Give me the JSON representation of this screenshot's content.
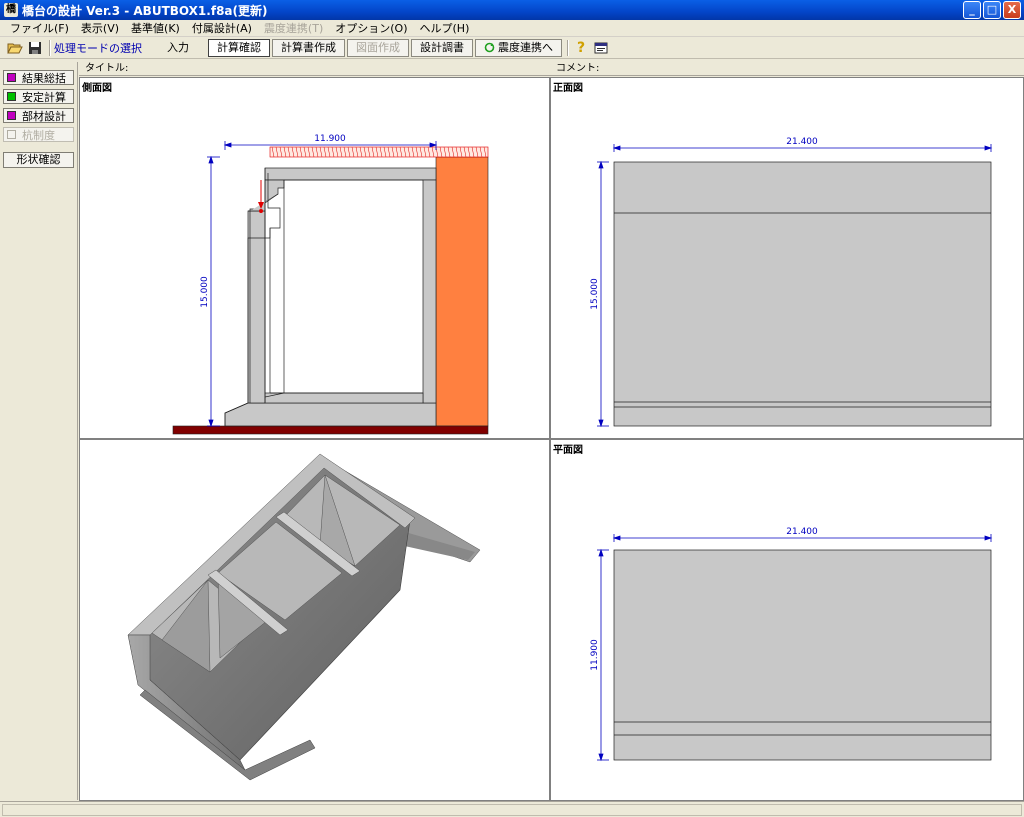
{
  "window": {
    "title": "橋台の設計 Ver.3 - ABUTBOX1.f8a(更新)",
    "app_icon": "橋",
    "buttons": [
      "_",
      "□",
      "X"
    ]
  },
  "menu": [
    {
      "label": "ファイル(F)",
      "enabled": true
    },
    {
      "label": "表示(V)",
      "enabled": true
    },
    {
      "label": "基準値(K)",
      "enabled": true
    },
    {
      "label": "付属設計(A)",
      "enabled": true
    },
    {
      "label": "震度連携(T)",
      "enabled": false
    },
    {
      "label": "オプション(O)",
      "enabled": true
    },
    {
      "label": "ヘルプ(H)",
      "enabled": true
    }
  ],
  "toolbar": {
    "open_icon": "folder-open-icon",
    "save_icon": "save-icon",
    "mode_label": "処理モードの選択",
    "buttons": [
      {
        "label": "入力",
        "state": "plain"
      },
      {
        "label": "計算確認",
        "state": "active"
      },
      {
        "label": "計算書作成",
        "state": "normal"
      },
      {
        "label": "図面作成",
        "state": "disabled"
      },
      {
        "label": "設計調書",
        "state": "normal"
      },
      {
        "label": "震度連携へ",
        "state": "normal"
      }
    ],
    "help_icon": "?",
    "about_icon": "window-icon"
  },
  "sidebar": {
    "items": [
      {
        "label": "結果総括",
        "color": "#C000C0",
        "enabled": true
      },
      {
        "label": "安定計算",
        "color": "#00C000",
        "enabled": true
      },
      {
        "label": "部材設計",
        "color": "#C000C0",
        "enabled": true
      },
      {
        "label": "杭制度",
        "color": "",
        "enabled": false
      }
    ],
    "tab": "形状確認"
  },
  "header": {
    "title_label": "タイトル:",
    "comment_label": "コメント:"
  },
  "views": {
    "side": {
      "label": "側面図",
      "width_dim": "11.900",
      "height_dim": "15.000"
    },
    "front": {
      "label": "正面図",
      "width_dim": "21.400",
      "height_dim": "15.000"
    },
    "plan": {
      "label": "平面図",
      "width_dim": "21.400",
      "height_dim": "11.900"
    },
    "iso": {
      "label": ""
    }
  },
  "colors": {
    "concrete": "#C8C8C8",
    "soil": "#FF8040",
    "footing_base": "#800000",
    "dimension": "#0000C0",
    "load": "#E00000"
  }
}
